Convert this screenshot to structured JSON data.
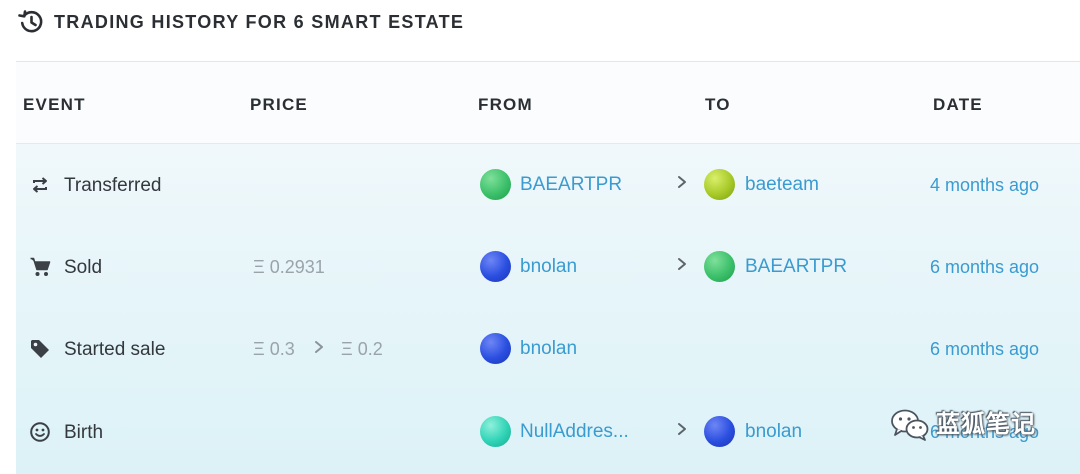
{
  "header": {
    "title": "TRADING HISTORY FOR 6 SMART ESTATE",
    "icon": "history-icon"
  },
  "columns": {
    "event": "EVENT",
    "price": "PRICE",
    "from": "FROM",
    "to": "TO",
    "date": "DATE"
  },
  "rows": [
    {
      "event": "Transferred",
      "icon": "transfer-icon",
      "price_from": "",
      "price_to": "",
      "from": "BAEARTPR",
      "to": "baeteam",
      "date": "4 months ago"
    },
    {
      "event": "Sold",
      "icon": "cart-icon",
      "price_from": "Ξ 0.2931",
      "price_to": "",
      "from": "bnolan",
      "to": "BAEARTPR",
      "date": "6 months ago"
    },
    {
      "event": "Started sale",
      "icon": "tag-icon",
      "price_from": "Ξ 0.3",
      "price_to": "Ξ 0.2",
      "from": "bnolan",
      "to": "",
      "date": "6 months ago"
    },
    {
      "event": "Birth",
      "icon": "smiley-icon",
      "price_from": "",
      "price_to": "",
      "from": "NullAddres...",
      "to": "bnolan",
      "date": "6 months ago"
    }
  ],
  "colors": {
    "link": "#3a9bd0",
    "text": "#2b2f33",
    "muted": "#9aa3aa",
    "avatar_green": "#3cc06a",
    "avatar_lime": "#a7c928",
    "avatar_blue": "#2a4ee0",
    "avatar_teal": "#2fd3b6"
  },
  "watermark": {
    "text": "蓝狐笔记",
    "icon": "wechat-logo-icon"
  }
}
